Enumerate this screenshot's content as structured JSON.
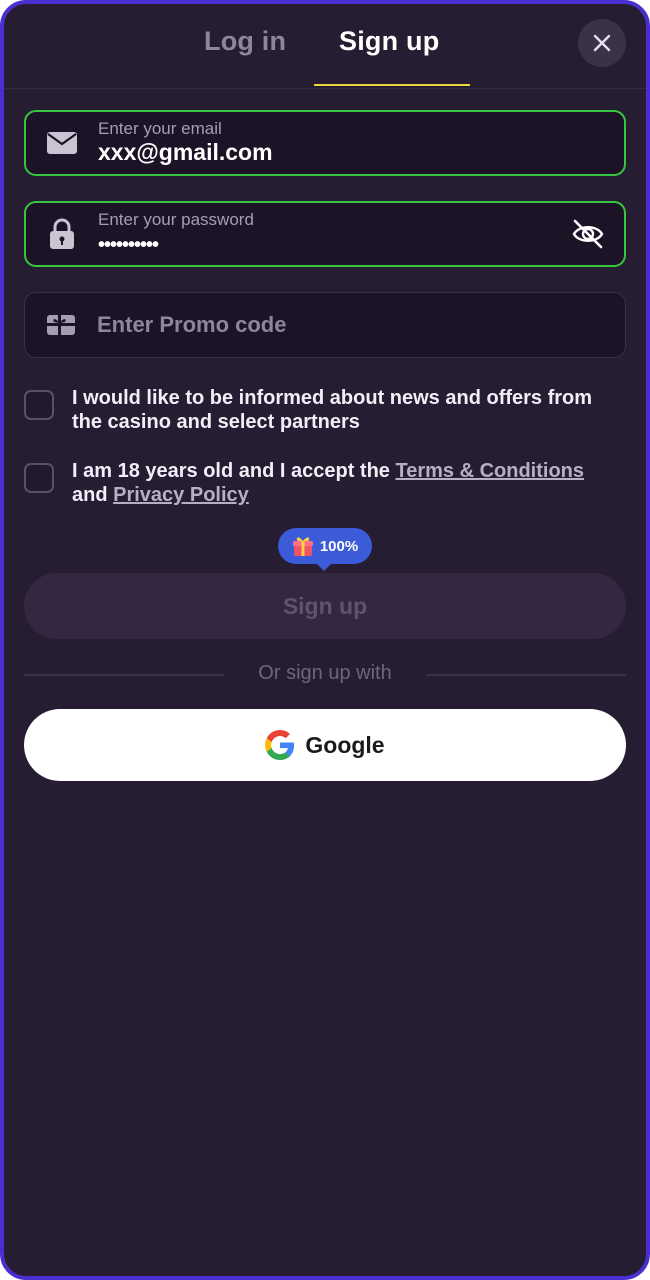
{
  "tabs": {
    "login": "Log in",
    "signup": "Sign up"
  },
  "email": {
    "label": "Enter your email",
    "value": "xxx@gmail.com"
  },
  "password": {
    "label": "Enter your password",
    "value": "••••••••••"
  },
  "promo": {
    "placeholder": "Enter Promo code"
  },
  "consent": {
    "news_text": "I would like to be informed about news and offers from the casino and select partners",
    "age_text_prefix": "I am 18 years old and I accept the ",
    "terms_link": "Terms & Conditions",
    "and_text": " and ",
    "privacy_link": "Privacy Policy"
  },
  "bonus_badge": {
    "value": "100%"
  },
  "signup_button": "Sign up",
  "divider_text": "Or sign up with",
  "google_button": "Google",
  "colors": {
    "accent_underline": "#e9d63c",
    "valid_border": "#35c73f",
    "badge": "#3b5bd8",
    "frame": "#4a2fd0"
  }
}
